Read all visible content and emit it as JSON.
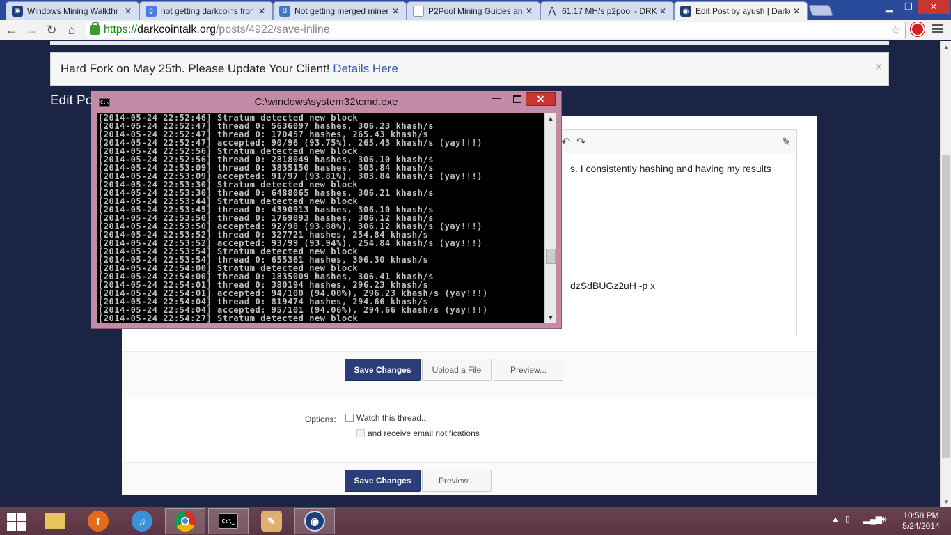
{
  "browser": {
    "tabs": [
      {
        "title": "Windows Mining Walkthr",
        "icon": "darkcoin-icon",
        "color": "#1f3f7a"
      },
      {
        "title": "not getting darkcoins fror",
        "icon": "google-icon",
        "color": "#4a7be0"
      },
      {
        "title": "Not getting merged miner",
        "icon": "bitcointalk-icon",
        "color": "#3d7ac2"
      },
      {
        "title": "P2Pool Mining Guides anc",
        "icon": "page-icon",
        "color": "#bbbbbb"
      },
      {
        "title": "61.17 MH/s p2pool - DRK",
        "icon": "p2pool-icon",
        "color": "#555555"
      },
      {
        "title": "Edit Post by ayush | Darkc",
        "icon": "darkcoin-icon",
        "color": "#1f3f7a"
      }
    ],
    "address": {
      "scheme": "https://",
      "host": "darkcointalk.org",
      "path": "/posts/4922/save-inline"
    }
  },
  "notice": {
    "text": "Hard Fork on May 25th. Please Update Your Client!",
    "link": "Details Here"
  },
  "page": {
    "heading": "Edit Po"
  },
  "editor": {
    "visible_text_1": "s. I consistently hashing and having my results",
    "visible_text_2": "dzSdBUGz2uH -p x"
  },
  "buttons": {
    "save_changes": "Save Changes",
    "upload_file": "Upload a File",
    "preview": "Preview..."
  },
  "options": {
    "label": "Options:",
    "watch_thread": "Watch this thread...",
    "email_notifications": "and receive email notifications"
  },
  "cmd": {
    "title": "C:\\windows\\system32\\cmd.exe",
    "lines": [
      "[2014-05-24 22:52:46] Stratum detected new block",
      "[2014-05-24 22:52:47] thread 0: 5636097 hashes, 306.23 khash/s",
      "[2014-05-24 22:52:47] thread 0: 170457 hashes, 265.43 khash/s",
      "[2014-05-24 22:52:47] accepted: 90/96 (93.75%), 265.43 khash/s (yay!!!)",
      "[2014-05-24 22:52:56] Stratum detected new block",
      "[2014-05-24 22:52:56] thread 0: 2818049 hashes, 306.10 khash/s",
      "[2014-05-24 22:53:09] thread 0: 3835150 hashes, 303.84 khash/s",
      "[2014-05-24 22:53:09] accepted: 91/97 (93.81%), 303.84 khash/s (yay!!!)",
      "[2014-05-24 22:53:30] Stratum detected new block",
      "[2014-05-24 22:53:30] thread 0: 6488065 hashes, 306.21 khash/s",
      "[2014-05-24 22:53:44] Stratum detected new block",
      "[2014-05-24 22:53:45] thread 0: 4390913 hashes, 306.10 khash/s",
      "[2014-05-24 22:53:50] thread 0: 1769093 hashes, 306.12 khash/s",
      "[2014-05-24 22:53:50] accepted: 92/98 (93.88%), 306.12 khash/s (yay!!!)",
      "[2014-05-24 22:53:52] thread 0: 327721 hashes, 254.84 khash/s",
      "[2014-05-24 22:53:52] accepted: 93/99 (93.94%), 254.84 khash/s (yay!!!)",
      "[2014-05-24 22:53:54] Stratum detected new block",
      "[2014-05-24 22:53:54] thread 0: 655361 hashes, 306.30 khash/s",
      "[2014-05-24 22:54:00] Stratum detected new block",
      "[2014-05-24 22:54:00] thread 0: 1835009 hashes, 306.41 khash/s",
      "[2014-05-24 22:54:01] thread 0: 380194 hashes, 296.23 khash/s",
      "[2014-05-24 22:54:01] accepted: 94/100 (94.00%), 296.23 khash/s (yay!!!)",
      "[2014-05-24 22:54:04] thread 0: 819474 hashes, 294.66 khash/s",
      "[2014-05-24 22:54:04] accepted: 95/101 (94.06%), 294.66 khash/s (yay!!!)",
      "[2014-05-24 22:54:27] Stratum detected new block"
    ]
  },
  "taskbar": {
    "apps": [
      "file-explorer-icon",
      "firefox-icon",
      "itunes-icon",
      "chrome-icon",
      "cmd-icon",
      "paint-icon",
      "darkcoin-wallet-icon"
    ],
    "time": "10:58 PM",
    "date": "5/24/2014"
  },
  "colors": {
    "page_bg": "#1b2444",
    "primary_button": "#2c3e79",
    "link": "#2f5ea8",
    "cmd_frame": "#c48ba6",
    "taskbar": "#5b3443"
  }
}
